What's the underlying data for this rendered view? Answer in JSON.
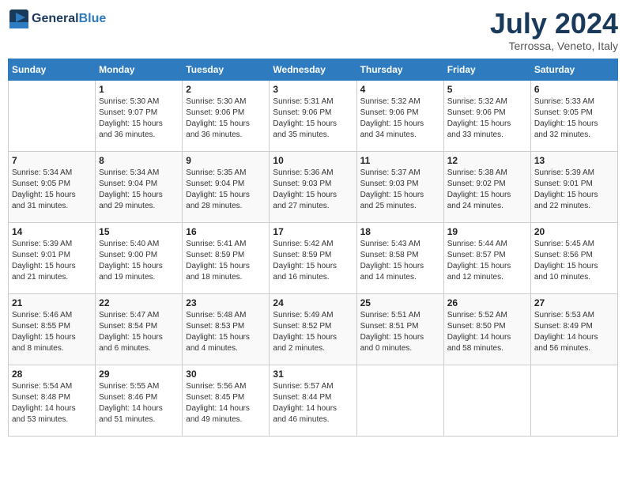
{
  "header": {
    "logo_line1": "General",
    "logo_line2": "Blue",
    "month_year": "July 2024",
    "location": "Terrossa, Veneto, Italy"
  },
  "days_of_week": [
    "Sunday",
    "Monday",
    "Tuesday",
    "Wednesday",
    "Thursday",
    "Friday",
    "Saturday"
  ],
  "weeks": [
    [
      {
        "day": "",
        "info": ""
      },
      {
        "day": "1",
        "info": "Sunrise: 5:30 AM\nSunset: 9:07 PM\nDaylight: 15 hours\nand 36 minutes."
      },
      {
        "day": "2",
        "info": "Sunrise: 5:30 AM\nSunset: 9:06 PM\nDaylight: 15 hours\nand 36 minutes."
      },
      {
        "day": "3",
        "info": "Sunrise: 5:31 AM\nSunset: 9:06 PM\nDaylight: 15 hours\nand 35 minutes."
      },
      {
        "day": "4",
        "info": "Sunrise: 5:32 AM\nSunset: 9:06 PM\nDaylight: 15 hours\nand 34 minutes."
      },
      {
        "day": "5",
        "info": "Sunrise: 5:32 AM\nSunset: 9:06 PM\nDaylight: 15 hours\nand 33 minutes."
      },
      {
        "day": "6",
        "info": "Sunrise: 5:33 AM\nSunset: 9:05 PM\nDaylight: 15 hours\nand 32 minutes."
      }
    ],
    [
      {
        "day": "7",
        "info": "Sunrise: 5:34 AM\nSunset: 9:05 PM\nDaylight: 15 hours\nand 31 minutes."
      },
      {
        "day": "8",
        "info": "Sunrise: 5:34 AM\nSunset: 9:04 PM\nDaylight: 15 hours\nand 29 minutes."
      },
      {
        "day": "9",
        "info": "Sunrise: 5:35 AM\nSunset: 9:04 PM\nDaylight: 15 hours\nand 28 minutes."
      },
      {
        "day": "10",
        "info": "Sunrise: 5:36 AM\nSunset: 9:03 PM\nDaylight: 15 hours\nand 27 minutes."
      },
      {
        "day": "11",
        "info": "Sunrise: 5:37 AM\nSunset: 9:03 PM\nDaylight: 15 hours\nand 25 minutes."
      },
      {
        "day": "12",
        "info": "Sunrise: 5:38 AM\nSunset: 9:02 PM\nDaylight: 15 hours\nand 24 minutes."
      },
      {
        "day": "13",
        "info": "Sunrise: 5:39 AM\nSunset: 9:01 PM\nDaylight: 15 hours\nand 22 minutes."
      }
    ],
    [
      {
        "day": "14",
        "info": "Sunrise: 5:39 AM\nSunset: 9:01 PM\nDaylight: 15 hours\nand 21 minutes."
      },
      {
        "day": "15",
        "info": "Sunrise: 5:40 AM\nSunset: 9:00 PM\nDaylight: 15 hours\nand 19 minutes."
      },
      {
        "day": "16",
        "info": "Sunrise: 5:41 AM\nSunset: 8:59 PM\nDaylight: 15 hours\nand 18 minutes."
      },
      {
        "day": "17",
        "info": "Sunrise: 5:42 AM\nSunset: 8:59 PM\nDaylight: 15 hours\nand 16 minutes."
      },
      {
        "day": "18",
        "info": "Sunrise: 5:43 AM\nSunset: 8:58 PM\nDaylight: 15 hours\nand 14 minutes."
      },
      {
        "day": "19",
        "info": "Sunrise: 5:44 AM\nSunset: 8:57 PM\nDaylight: 15 hours\nand 12 minutes."
      },
      {
        "day": "20",
        "info": "Sunrise: 5:45 AM\nSunset: 8:56 PM\nDaylight: 15 hours\nand 10 minutes."
      }
    ],
    [
      {
        "day": "21",
        "info": "Sunrise: 5:46 AM\nSunset: 8:55 PM\nDaylight: 15 hours\nand 8 minutes."
      },
      {
        "day": "22",
        "info": "Sunrise: 5:47 AM\nSunset: 8:54 PM\nDaylight: 15 hours\nand 6 minutes."
      },
      {
        "day": "23",
        "info": "Sunrise: 5:48 AM\nSunset: 8:53 PM\nDaylight: 15 hours\nand 4 minutes."
      },
      {
        "day": "24",
        "info": "Sunrise: 5:49 AM\nSunset: 8:52 PM\nDaylight: 15 hours\nand 2 minutes."
      },
      {
        "day": "25",
        "info": "Sunrise: 5:51 AM\nSunset: 8:51 PM\nDaylight: 15 hours\nand 0 minutes."
      },
      {
        "day": "26",
        "info": "Sunrise: 5:52 AM\nSunset: 8:50 PM\nDaylight: 14 hours\nand 58 minutes."
      },
      {
        "day": "27",
        "info": "Sunrise: 5:53 AM\nSunset: 8:49 PM\nDaylight: 14 hours\nand 56 minutes."
      }
    ],
    [
      {
        "day": "28",
        "info": "Sunrise: 5:54 AM\nSunset: 8:48 PM\nDaylight: 14 hours\nand 53 minutes."
      },
      {
        "day": "29",
        "info": "Sunrise: 5:55 AM\nSunset: 8:46 PM\nDaylight: 14 hours\nand 51 minutes."
      },
      {
        "day": "30",
        "info": "Sunrise: 5:56 AM\nSunset: 8:45 PM\nDaylight: 14 hours\nand 49 minutes."
      },
      {
        "day": "31",
        "info": "Sunrise: 5:57 AM\nSunset: 8:44 PM\nDaylight: 14 hours\nand 46 minutes."
      },
      {
        "day": "",
        "info": ""
      },
      {
        "day": "",
        "info": ""
      },
      {
        "day": "",
        "info": ""
      }
    ]
  ]
}
